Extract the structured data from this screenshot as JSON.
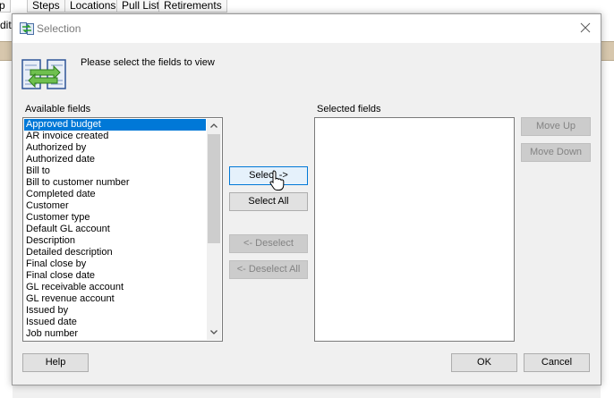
{
  "background": {
    "tabs": [
      "Steps",
      "Locations",
      "Pull List",
      "Retirements"
    ],
    "left_fragment_top": "p",
    "left_fragment_row": "dit"
  },
  "dialog": {
    "title": "Selection",
    "instruction": "Please select the fields to view",
    "available_label": "Available fields",
    "selected_label": "Selected fields",
    "available_fields": [
      "Approved budget",
      "AR invoice created",
      "Authorized by",
      "Authorized date",
      "Bill to",
      "Bill to customer number",
      "Completed date",
      "Customer",
      "Customer type",
      "Default GL account",
      "Description",
      "Detailed description",
      "Final close by",
      "Final close date",
      "GL receivable account",
      "GL revenue account",
      "Issued by",
      "Issued date",
      "Job number"
    ],
    "selected_index": 0,
    "selected_fields": [],
    "buttons": {
      "select": "Select ->",
      "select_all": "Select All",
      "deselect": "<- Deselect",
      "deselect_all": "<- Deselect All",
      "move_up": "Move Up",
      "move_down": "Move Down",
      "help": "Help",
      "ok": "OK",
      "cancel": "Cancel"
    }
  },
  "icons": {
    "title": "selection-app-icon",
    "large": "field-transfer-icon",
    "close": "close-icon",
    "scroll_up": "scroll-up-arrow-icon",
    "scroll_down": "scroll-down-arrow-icon",
    "cursor": "mouse-pointer-icon"
  },
  "colors": {
    "selection": "#0078d7",
    "disabled_text": "#838383",
    "dialog_bg": "#f0f0f0"
  }
}
